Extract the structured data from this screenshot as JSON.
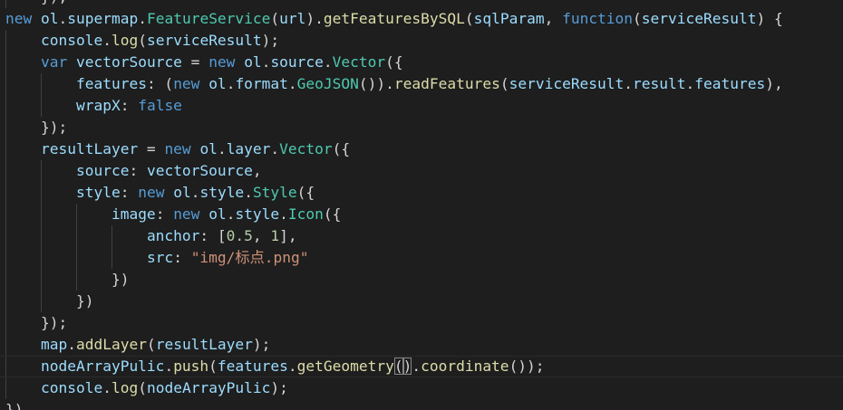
{
  "editor": {
    "colors": {
      "background": "#1e1e1e",
      "keyword": "#569cd6",
      "variable": "#9cdcfe",
      "class": "#4ec9b0",
      "function": "#dcdcaa",
      "number": "#b5cea8",
      "string": "#ce9178",
      "punctuation": "#d4d4d4"
    },
    "lines": [
      {
        "indent": 1,
        "tokens": [
          {
            "t": "});",
            "c": "p"
          }
        ]
      },
      {
        "indent": 0,
        "tokens": [
          {
            "t": "new",
            "c": "kw"
          },
          {
            "t": " ",
            "c": "p"
          },
          {
            "t": "ol",
            "c": "var"
          },
          {
            "t": ".",
            "c": "p"
          },
          {
            "t": "supermap",
            "c": "var"
          },
          {
            "t": ".",
            "c": "p"
          },
          {
            "t": "FeatureService",
            "c": "cls"
          },
          {
            "t": "(",
            "c": "p"
          },
          {
            "t": "url",
            "c": "var"
          },
          {
            "t": ").",
            "c": "p"
          },
          {
            "t": "getFeaturesBySQL",
            "c": "fn"
          },
          {
            "t": "(",
            "c": "p"
          },
          {
            "t": "sqlParam",
            "c": "var"
          },
          {
            "t": ", ",
            "c": "p"
          },
          {
            "t": "function",
            "c": "kw"
          },
          {
            "t": "(",
            "c": "p"
          },
          {
            "t": "serviceResult",
            "c": "var"
          },
          {
            "t": ") {",
            "c": "p"
          }
        ]
      },
      {
        "indent": 1,
        "tokens": [
          {
            "t": "console",
            "c": "var"
          },
          {
            "t": ".",
            "c": "p"
          },
          {
            "t": "log",
            "c": "fn"
          },
          {
            "t": "(",
            "c": "p"
          },
          {
            "t": "serviceResult",
            "c": "var"
          },
          {
            "t": ");",
            "c": "p"
          }
        ]
      },
      {
        "indent": 1,
        "tokens": [
          {
            "t": "var",
            "c": "kw"
          },
          {
            "t": " ",
            "c": "p"
          },
          {
            "t": "vectorSource",
            "c": "var"
          },
          {
            "t": " = ",
            "c": "p"
          },
          {
            "t": "new",
            "c": "kw"
          },
          {
            "t": " ",
            "c": "p"
          },
          {
            "t": "ol",
            "c": "var"
          },
          {
            "t": ".",
            "c": "p"
          },
          {
            "t": "source",
            "c": "var"
          },
          {
            "t": ".",
            "c": "p"
          },
          {
            "t": "Vector",
            "c": "cls"
          },
          {
            "t": "({",
            "c": "p"
          }
        ]
      },
      {
        "indent": 2,
        "tokens": [
          {
            "t": "features",
            "c": "var"
          },
          {
            "t": ": (",
            "c": "p"
          },
          {
            "t": "new",
            "c": "kw"
          },
          {
            "t": " ",
            "c": "p"
          },
          {
            "t": "ol",
            "c": "var"
          },
          {
            "t": ".",
            "c": "p"
          },
          {
            "t": "format",
            "c": "var"
          },
          {
            "t": ".",
            "c": "p"
          },
          {
            "t": "GeoJSON",
            "c": "cls"
          },
          {
            "t": "()).",
            "c": "p"
          },
          {
            "t": "readFeatures",
            "c": "fn"
          },
          {
            "t": "(",
            "c": "p"
          },
          {
            "t": "serviceResult",
            "c": "var"
          },
          {
            "t": ".",
            "c": "p"
          },
          {
            "t": "result",
            "c": "var"
          },
          {
            "t": ".",
            "c": "p"
          },
          {
            "t": "features",
            "c": "var"
          },
          {
            "t": "),",
            "c": "p"
          }
        ]
      },
      {
        "indent": 2,
        "tokens": [
          {
            "t": "wrapX",
            "c": "var"
          },
          {
            "t": ": ",
            "c": "p"
          },
          {
            "t": "false",
            "c": "kw"
          }
        ]
      },
      {
        "indent": 1,
        "tokens": [
          {
            "t": "});",
            "c": "p"
          }
        ]
      },
      {
        "indent": 1,
        "tokens": [
          {
            "t": "resultLayer",
            "c": "var"
          },
          {
            "t": " = ",
            "c": "p"
          },
          {
            "t": "new",
            "c": "kw"
          },
          {
            "t": " ",
            "c": "p"
          },
          {
            "t": "ol",
            "c": "var"
          },
          {
            "t": ".",
            "c": "p"
          },
          {
            "t": "layer",
            "c": "var"
          },
          {
            "t": ".",
            "c": "p"
          },
          {
            "t": "Vector",
            "c": "cls"
          },
          {
            "t": "({",
            "c": "p"
          }
        ]
      },
      {
        "indent": 2,
        "tokens": [
          {
            "t": "source",
            "c": "var"
          },
          {
            "t": ": ",
            "c": "p"
          },
          {
            "t": "vectorSource",
            "c": "var"
          },
          {
            "t": ",",
            "c": "p"
          }
        ]
      },
      {
        "indent": 2,
        "tokens": [
          {
            "t": "style",
            "c": "var"
          },
          {
            "t": ": ",
            "c": "p"
          },
          {
            "t": "new",
            "c": "kw"
          },
          {
            "t": " ",
            "c": "p"
          },
          {
            "t": "ol",
            "c": "var"
          },
          {
            "t": ".",
            "c": "p"
          },
          {
            "t": "style",
            "c": "var"
          },
          {
            "t": ".",
            "c": "p"
          },
          {
            "t": "Style",
            "c": "cls"
          },
          {
            "t": "({",
            "c": "p"
          }
        ]
      },
      {
        "indent": 3,
        "tokens": [
          {
            "t": "image",
            "c": "var"
          },
          {
            "t": ": ",
            "c": "p"
          },
          {
            "t": "new",
            "c": "kw"
          },
          {
            "t": " ",
            "c": "p"
          },
          {
            "t": "ol",
            "c": "var"
          },
          {
            "t": ".",
            "c": "p"
          },
          {
            "t": "style",
            "c": "var"
          },
          {
            "t": ".",
            "c": "p"
          },
          {
            "t": "Icon",
            "c": "cls"
          },
          {
            "t": "({",
            "c": "p"
          }
        ]
      },
      {
        "indent": 4,
        "tokens": [
          {
            "t": "anchor",
            "c": "var"
          },
          {
            "t": ": [",
            "c": "p"
          },
          {
            "t": "0.5",
            "c": "num"
          },
          {
            "t": ", ",
            "c": "p"
          },
          {
            "t": "1",
            "c": "num"
          },
          {
            "t": "],",
            "c": "p"
          }
        ]
      },
      {
        "indent": 4,
        "tokens": [
          {
            "t": "src",
            "c": "var"
          },
          {
            "t": ": ",
            "c": "p"
          },
          {
            "t": "\"img/标点.png\"",
            "c": "str"
          }
        ]
      },
      {
        "indent": 3,
        "tokens": [
          {
            "t": "})",
            "c": "p"
          }
        ]
      },
      {
        "indent": 2,
        "tokens": [
          {
            "t": "})",
            "c": "p"
          }
        ]
      },
      {
        "indent": 1,
        "tokens": [
          {
            "t": "});",
            "c": "p"
          }
        ]
      },
      {
        "indent": 1,
        "tokens": [
          {
            "t": "map",
            "c": "var"
          },
          {
            "t": ".",
            "c": "p"
          },
          {
            "t": "addLayer",
            "c": "fn"
          },
          {
            "t": "(",
            "c": "p"
          },
          {
            "t": "resultLayer",
            "c": "var"
          },
          {
            "t": ");",
            "c": "p"
          }
        ]
      },
      {
        "indent": 1,
        "current": true,
        "tokens": [
          {
            "t": "nodeArrayPulic",
            "c": "var"
          },
          {
            "t": ".",
            "c": "p"
          },
          {
            "t": "push",
            "c": "fn"
          },
          {
            "t": "(",
            "c": "p"
          },
          {
            "t": "features",
            "c": "var"
          },
          {
            "t": ".",
            "c": "p"
          },
          {
            "t": "getGeometry",
            "c": "fn"
          },
          {
            "t": "(",
            "c": "bm"
          },
          {
            "t": ")",
            "c": "bm"
          },
          {
            "t": ".",
            "c": "p"
          },
          {
            "t": "coordinate",
            "c": "fn"
          },
          {
            "t": "());",
            "c": "p"
          }
        ]
      },
      {
        "indent": 1,
        "tokens": [
          {
            "t": "console",
            "c": "var"
          },
          {
            "t": ".",
            "c": "p"
          },
          {
            "t": "log",
            "c": "fn"
          },
          {
            "t": "(",
            "c": "p"
          },
          {
            "t": "nodeArrayPulic",
            "c": "var"
          },
          {
            "t": ");",
            "c": "p"
          }
        ]
      },
      {
        "indent": 0,
        "tokens": [
          {
            "t": "})",
            "c": "p"
          }
        ]
      }
    ]
  }
}
